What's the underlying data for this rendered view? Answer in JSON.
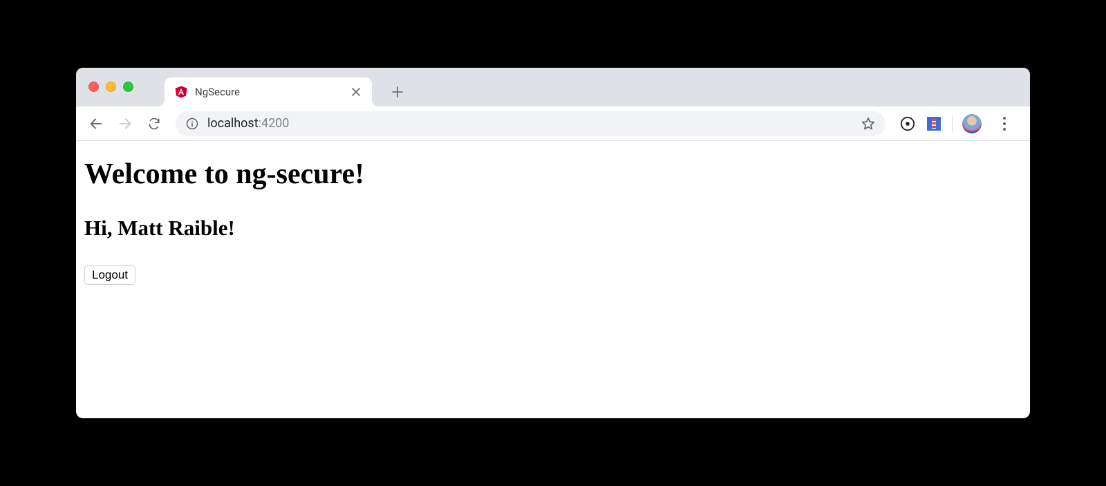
{
  "browser": {
    "tab": {
      "title": "NgSecure",
      "favicon_name": "angular-icon"
    },
    "url_host": "localhost",
    "url_port": ":4200"
  },
  "page": {
    "heading": "Welcome to ng-secure!",
    "greeting": "Hi, Matt Raible!",
    "logout_label": "Logout"
  }
}
